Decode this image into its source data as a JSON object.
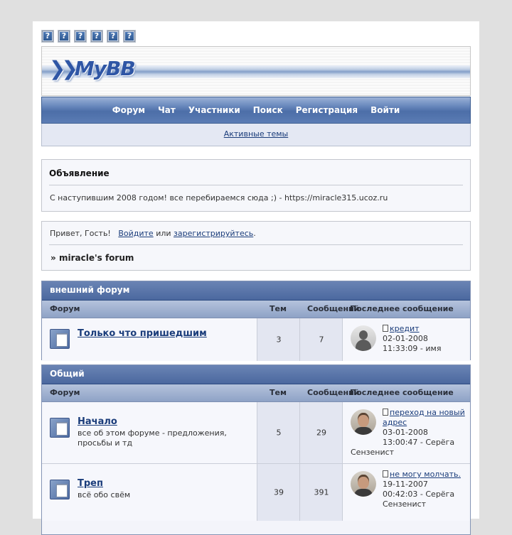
{
  "toolbar": {
    "icons": [
      "?",
      "?",
      "?",
      "?",
      "?",
      "?"
    ]
  },
  "header": {
    "logo_text": "MyBB"
  },
  "nav": {
    "items": [
      "Форум",
      "Чат",
      "Участники",
      "Поиск",
      "Регистрация",
      "Войти"
    ],
    "active_topics": "Активные темы"
  },
  "announcement": {
    "title": "Объявление",
    "text": "С наступившим 2008 годом! все перебираемся сюда ;) - https://miracle315.ucoz.ru"
  },
  "welcome": {
    "greeting": "Привет, Гость!",
    "login": "Войдите",
    "or": "или",
    "register": "зарегистрируйтесь",
    "period": ".",
    "crumb_arrow": "»",
    "crumb_label": "miracle's forum"
  },
  "columns": {
    "forum": "Форум",
    "topics": "Тем",
    "posts": "Сообщений",
    "last": "Последнее сообщение"
  },
  "categories": [
    {
      "title": "внешний форум",
      "forums": [
        {
          "name": "Только что пришедшим",
          "description": "",
          "topics": "3",
          "posts": "7",
          "last_title": "кредит",
          "last_date": "02-01-2008",
          "last_time_author": "11:33:09 - имя",
          "last_extra": "",
          "avatar": "default"
        }
      ]
    },
    {
      "title": "Общий",
      "forums": [
        {
          "name": "Начало",
          "description": "все об этом форуме - предложения, просьбы и тд",
          "topics": "5",
          "posts": "29",
          "last_title": "переход на новый адрес",
          "last_date": "03-01-2008",
          "last_time_author": "13:00:47 - Серёга",
          "last_extra": "Сензенист",
          "avatar": "photo"
        },
        {
          "name": "Треп",
          "description": "всё обо свём",
          "topics": "39",
          "posts": "391",
          "last_title": "не могу молчать.",
          "last_date": "19-11-2007",
          "last_time_author": "00:42:03 - Серёга",
          "last_extra": "Сензенист",
          "avatar": "photo"
        }
      ]
    }
  ]
}
